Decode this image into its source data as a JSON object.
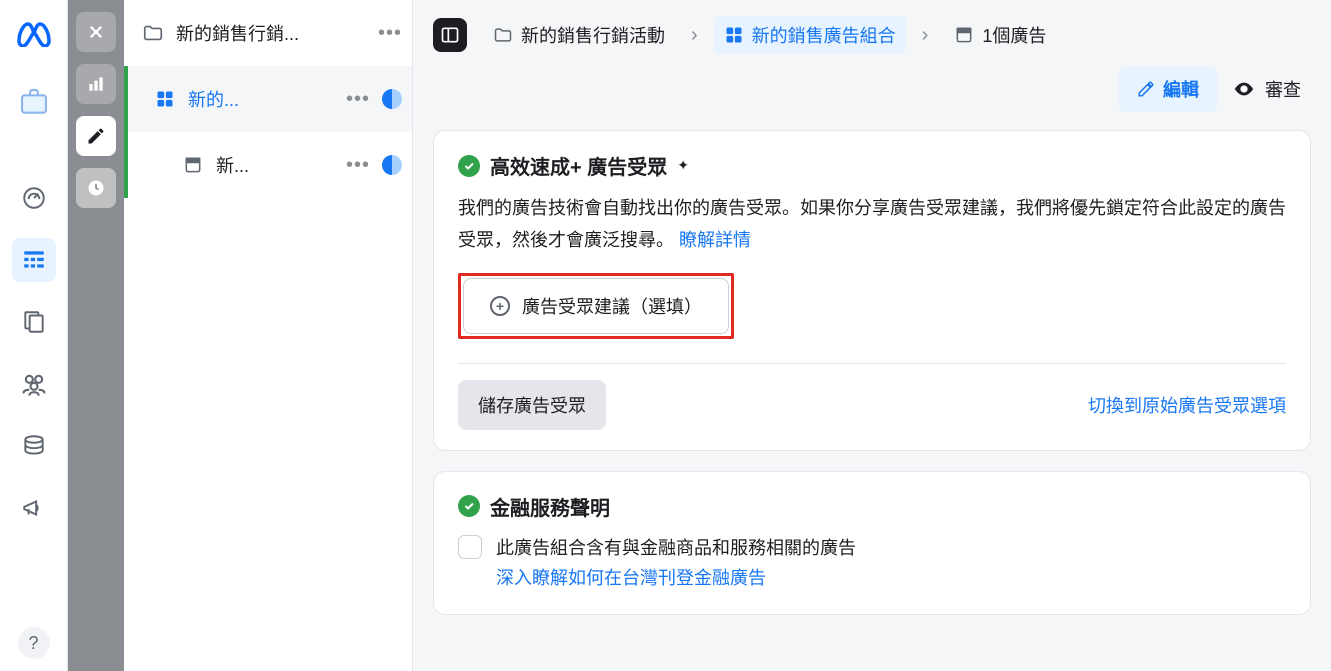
{
  "tree": {
    "campaign": "新的銷售行銷...",
    "adset": "新的...",
    "ad": "新..."
  },
  "breadcrumb": {
    "campaign": "新的銷售行銷活動",
    "adset": "新的銷售廣告組合",
    "ads": "1個廣告"
  },
  "actions": {
    "edit": "編輯",
    "review": "審查"
  },
  "card_audience": {
    "title": "高效速成+ 廣告受眾",
    "desc_pre": "我們的廣告技術會自動找出你的廣告受眾。如果你分享廣告受眾建議，我們將優先鎖定符合此設定的廣告受眾，然後才會廣泛搜尋。",
    "learn_more": "瞭解詳情",
    "suggest_btn": "廣告受眾建議（選填）",
    "save_btn": "儲存廣告受眾",
    "switch_link": "切換到原始廣告受眾選項"
  },
  "card_finance": {
    "title": "金融服務聲明",
    "checkbox_label": "此廣告組合含有與金融商品和服務相關的廣告",
    "sub_link": "深入瞭解如何在台灣刊登金融廣告"
  }
}
